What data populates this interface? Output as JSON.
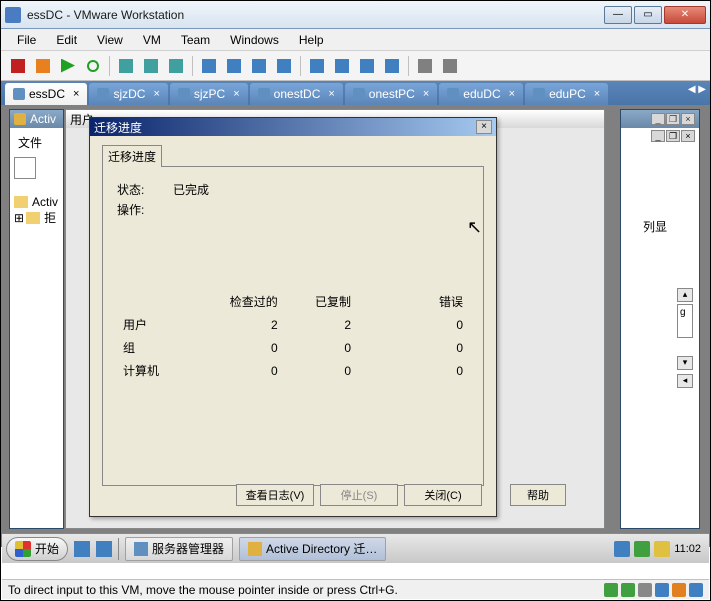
{
  "window": {
    "title": "essDC - VMware Workstation"
  },
  "menu": {
    "file": "File",
    "edit": "Edit",
    "view": "View",
    "vm": "VM",
    "team": "Team",
    "windows": "Windows",
    "help": "Help"
  },
  "tabs": [
    {
      "label": "essDC",
      "active": true
    },
    {
      "label": "sjzDC"
    },
    {
      "label": "sjzPC"
    },
    {
      "label": "onestDC"
    },
    {
      "label": "onestPC"
    },
    {
      "label": "eduDC"
    },
    {
      "label": "eduPC"
    }
  ],
  "mdi": {
    "active_title": "Activ",
    "file_btn": "文件",
    "tree_item": "Activ",
    "tree_expand": "拒"
  },
  "user_window": {
    "title_prefix": "用户"
  },
  "right": {
    "list_label": "列显",
    "g": "g"
  },
  "dialog": {
    "title": "迁移进度",
    "tab": "迁移进度",
    "status_label": "状态:",
    "status_value": "已完成",
    "op_label": "操作:",
    "headers": {
      "checked": "检查过的",
      "copied": "已复制",
      "errors": "错误"
    },
    "rows": [
      {
        "label": "用户",
        "checked": 2,
        "copied": 2,
        "errors": 0
      },
      {
        "label": "组",
        "checked": 0,
        "copied": 0,
        "errors": 0
      },
      {
        "label": "计算机",
        "checked": 0,
        "copied": 0,
        "errors": 0
      }
    ],
    "buttons": {
      "log": "查看日志(V)",
      "stop": "停止(S)",
      "close": "关闭(C)"
    }
  },
  "help": "帮助",
  "taskbar": {
    "start": "开始",
    "items": [
      {
        "label": "服务器管理器"
      },
      {
        "label": "Active Directory 迁…"
      }
    ],
    "clock": "11:02"
  },
  "statusbar": {
    "hint": "To direct input to this VM, move the mouse pointer inside or press Ctrl+G."
  }
}
